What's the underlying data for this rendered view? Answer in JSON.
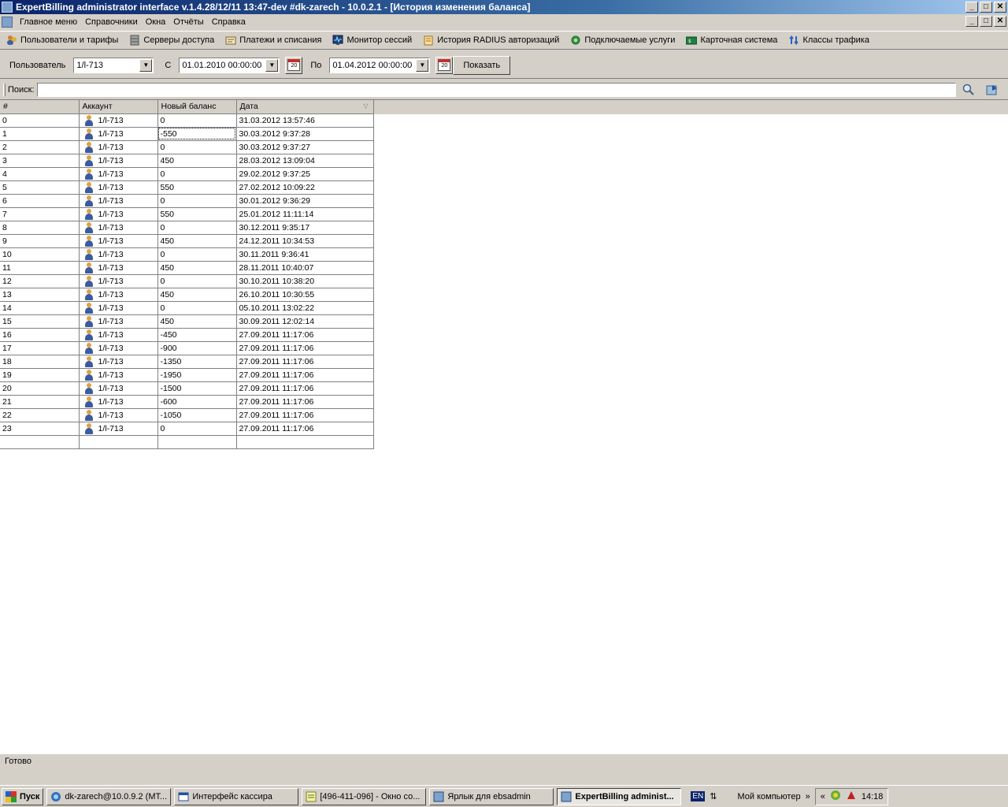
{
  "window": {
    "title": "ExpertBilling administrator interface v.1.4.28/12/11 13:47-dev #dk-zarech - 10.0.2.1 - [История изменения баланса]",
    "controls": {
      "minimize": "_",
      "maximize": "□",
      "close": "✕"
    }
  },
  "menu": {
    "items": [
      "Главное меню",
      "Справочники",
      "Окна",
      "Отчёты",
      "Справка"
    ]
  },
  "toolbar": {
    "items": [
      {
        "label": "Пользователи и тарифы",
        "icon": "users-icon"
      },
      {
        "label": "Серверы доступа",
        "icon": "servers-icon"
      },
      {
        "label": "Платежи и списания",
        "icon": "payments-icon"
      },
      {
        "label": "Монитор сессий",
        "icon": "monitor-icon"
      },
      {
        "label": "История RADIUS авторизаций",
        "icon": "radius-history-icon"
      },
      {
        "label": "Подключаемые услуги",
        "icon": "services-icon"
      },
      {
        "label": "Карточная система",
        "icon": "card-icon"
      },
      {
        "label": "Классы трафика",
        "icon": "traffic-classes-icon"
      }
    ]
  },
  "filter": {
    "user_label": "Пользователь",
    "user_value": "1/l-713",
    "from_label": "С",
    "from_value": "01.01.2010 00:00:00",
    "to_label": "По",
    "to_value": "01.04.2012 00:00:00",
    "calendar_day": "20",
    "show_button": "Показать"
  },
  "search": {
    "label": "Поиск:",
    "value": ""
  },
  "grid": {
    "columns": [
      "#",
      "Аккаунт",
      "Новый баланс",
      "Дата"
    ],
    "rows": [
      {
        "num": "0",
        "account": "1/l-713",
        "balance": "0",
        "date": "31.03.2012 13:57:46"
      },
      {
        "num": "1",
        "account": "1/l-713",
        "balance": "-550",
        "date": "30.03.2012 9:37:28"
      },
      {
        "num": "2",
        "account": "1/l-713",
        "balance": "0",
        "date": "30.03.2012 9:37:27"
      },
      {
        "num": "3",
        "account": "1/l-713",
        "balance": "450",
        "date": "28.03.2012 13:09:04"
      },
      {
        "num": "4",
        "account": "1/l-713",
        "balance": "0",
        "date": "29.02.2012 9:37:25"
      },
      {
        "num": "5",
        "account": "1/l-713",
        "balance": "550",
        "date": "27.02.2012 10:09:22"
      },
      {
        "num": "6",
        "account": "1/l-713",
        "balance": "0",
        "date": "30.01.2012 9:36:29"
      },
      {
        "num": "7",
        "account": "1/l-713",
        "balance": "550",
        "date": "25.01.2012 11:11:14"
      },
      {
        "num": "8",
        "account": "1/l-713",
        "balance": "0",
        "date": "30.12.2011 9:35:17"
      },
      {
        "num": "9",
        "account": "1/l-713",
        "balance": "450",
        "date": "24.12.2011 10:34:53"
      },
      {
        "num": "10",
        "account": "1/l-713",
        "balance": "0",
        "date": "30.11.2011 9:36:41"
      },
      {
        "num": "11",
        "account": "1/l-713",
        "balance": "450",
        "date": "28.11.2011 10:40:07"
      },
      {
        "num": "12",
        "account": "1/l-713",
        "balance": "0",
        "date": "30.10.2011 10:38:20"
      },
      {
        "num": "13",
        "account": "1/l-713",
        "balance": "450",
        "date": "26.10.2011 10:30:55"
      },
      {
        "num": "14",
        "account": "1/l-713",
        "balance": "0",
        "date": "05.10.2011 13:02:22"
      },
      {
        "num": "15",
        "account": "1/l-713",
        "balance": "450",
        "date": "30.09.2011 12:02:14"
      },
      {
        "num": "16",
        "account": "1/l-713",
        "balance": "-450",
        "date": "27.09.2011 11:17:06"
      },
      {
        "num": "17",
        "account": "1/l-713",
        "balance": "-900",
        "date": "27.09.2011 11:17:06"
      },
      {
        "num": "18",
        "account": "1/l-713",
        "balance": "-1350",
        "date": "27.09.2011 11:17:06"
      },
      {
        "num": "19",
        "account": "1/l-713",
        "balance": "-1950",
        "date": "27.09.2011 11:17:06"
      },
      {
        "num": "20",
        "account": "1/l-713",
        "balance": "-1500",
        "date": "27.09.2011 11:17:06"
      },
      {
        "num": "21",
        "account": "1/l-713",
        "balance": "-600",
        "date": "27.09.2011 11:17:06"
      },
      {
        "num": "22",
        "account": "1/l-713",
        "balance": "-1050",
        "date": "27.09.2011 11:17:06"
      },
      {
        "num": "23",
        "account": "1/l-713",
        "balance": "0",
        "date": "27.09.2011 11:17:06"
      }
    ]
  },
  "status": {
    "text": "Готово"
  },
  "taskbar": {
    "start": "Пуск",
    "tasks": [
      {
        "label": "dk-zarech@10.0.9.2 (MT...",
        "active": false
      },
      {
        "label": "Интерфейс кассира",
        "active": false
      },
      {
        "label": "[496-411-096] - Окно со...",
        "active": false
      },
      {
        "label": "Ярлык для ebsadmin",
        "active": false
      },
      {
        "label": "ExpertBilling administ...",
        "active": true
      }
    ],
    "lang": "EN",
    "my_computer": "Мой компьютер",
    "clock": "14:18"
  },
  "colors": {
    "titlebar_start": "#0a246a",
    "window_face": "#d4d0c8",
    "grid_background": "#ffffff"
  }
}
